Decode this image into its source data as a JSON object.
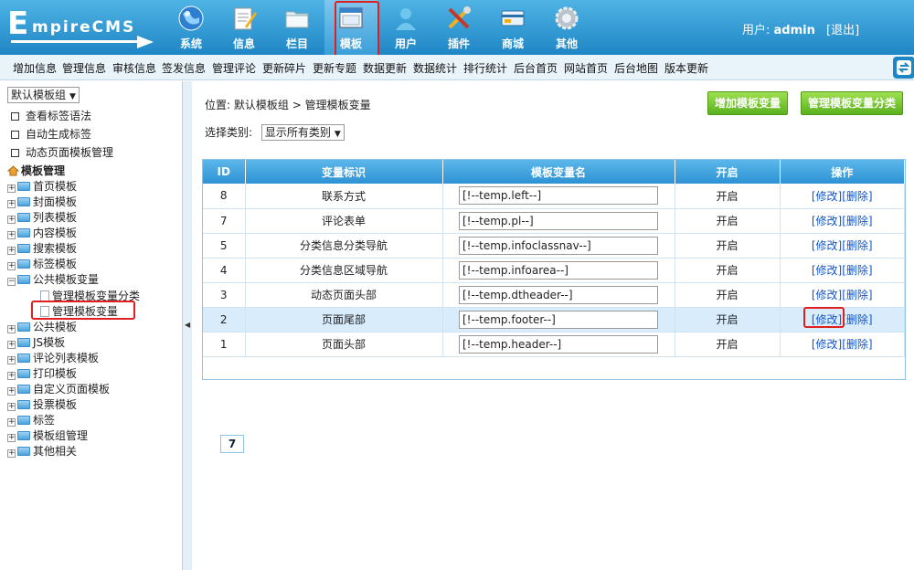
{
  "header": {
    "logo_e": "E",
    "logo_rest": "mpireCMS",
    "nav": [
      {
        "label": "系统",
        "icon": "globe-icon"
      },
      {
        "label": "信息",
        "icon": "notepad-icon"
      },
      {
        "label": "栏目",
        "icon": "folder-icon"
      },
      {
        "label": "模板",
        "icon": "window-icon"
      },
      {
        "label": "用户",
        "icon": "user-icon"
      },
      {
        "label": "插件",
        "icon": "tools-icon"
      },
      {
        "label": "商城",
        "icon": "card-icon"
      },
      {
        "label": "其他",
        "icon": "gear-icon"
      }
    ],
    "user_prefix": "用户:",
    "user_name": "admin",
    "logout": "[退出]"
  },
  "menu": [
    "增加信息",
    "管理信息",
    "审核信息",
    "签发信息",
    "管理评论",
    "更新碎片",
    "更新专题",
    "数据更新",
    "数据统计",
    "排行统计",
    "后台首页",
    "网站首页",
    "后台地图",
    "版本更新"
  ],
  "sidebar": {
    "group_select": "默认模板组",
    "links": [
      "查看标签语法",
      "自动生成标签",
      "动态页面模板管理"
    ],
    "root": "模板管理",
    "tree": [
      "首页模板",
      "封面模板",
      "列表模板",
      "内容模板",
      "搜索模板",
      "标签模板",
      "公共模板变量"
    ],
    "subtree": [
      "管理模板变量分类",
      "管理模板变量"
    ],
    "tree2": [
      "公共模板",
      "JS模板",
      "评论列表模板",
      "打印模板",
      "自定义页面模板",
      "投票模板",
      "标签",
      "模板组管理",
      "其他相关"
    ]
  },
  "main": {
    "breadcrumb_prefix": "位置:",
    "breadcrumb_group": "默认模板组",
    "breadcrumb_sep": ">",
    "breadcrumb_page": "管理模板变量",
    "btn_add": "增加模板变量",
    "btn_manage_class": "管理模板变量分类",
    "category_label": "选择类别:",
    "category_value": "显示所有类别",
    "columns": [
      "ID",
      "变量标识",
      "模板变量名",
      "开启",
      "操作"
    ],
    "rows": [
      {
        "id": "8",
        "name": "联系方式",
        "var": "[!--temp.left--]",
        "open": "开启"
      },
      {
        "id": "7",
        "name": "评论表单",
        "var": "[!--temp.pl--]",
        "open": "开启"
      },
      {
        "id": "5",
        "name": "分类信息分类导航",
        "var": "[!--temp.infoclassnav--]",
        "open": "开启"
      },
      {
        "id": "4",
        "name": "分类信息区域导航",
        "var": "[!--temp.infoarea--]",
        "open": "开启"
      },
      {
        "id": "3",
        "name": "动态页面头部",
        "var": "[!--temp.dtheader--]",
        "open": "开启"
      },
      {
        "id": "2",
        "name": "页面尾部",
        "var": "[!--temp.footer--]",
        "open": "开启"
      },
      {
        "id": "1",
        "name": "页面头部",
        "var": "[!--temp.header--]",
        "open": "开启"
      }
    ],
    "edit_label": "[修改]",
    "delete_label": "[删除]",
    "total": "7"
  }
}
